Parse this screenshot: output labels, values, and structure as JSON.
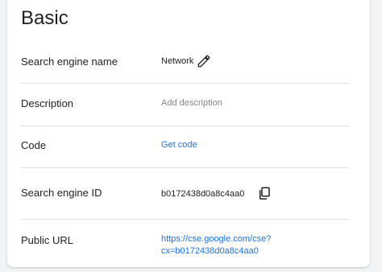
{
  "section": {
    "title": "Basic"
  },
  "rows": [
    {
      "label": "Search engine name",
      "value": "Network",
      "icon": "edit-icon"
    },
    {
      "label": "Description",
      "placeholder": "Add description"
    },
    {
      "label": "Code",
      "link_text": "Get code"
    },
    {
      "label": "Search engine ID",
      "value": "b0172438d0a8c4aa0",
      "icon": "copy-icon"
    },
    {
      "label": "Public URL",
      "url_line1": "https://cse.google.com/cse?",
      "url_line2": "cx=b0172438d0a8c4aa0"
    }
  ],
  "colors": {
    "link": "#1a73e8",
    "text": "#202124",
    "placeholder": "#80868b",
    "divider": "#e0e0e0"
  }
}
